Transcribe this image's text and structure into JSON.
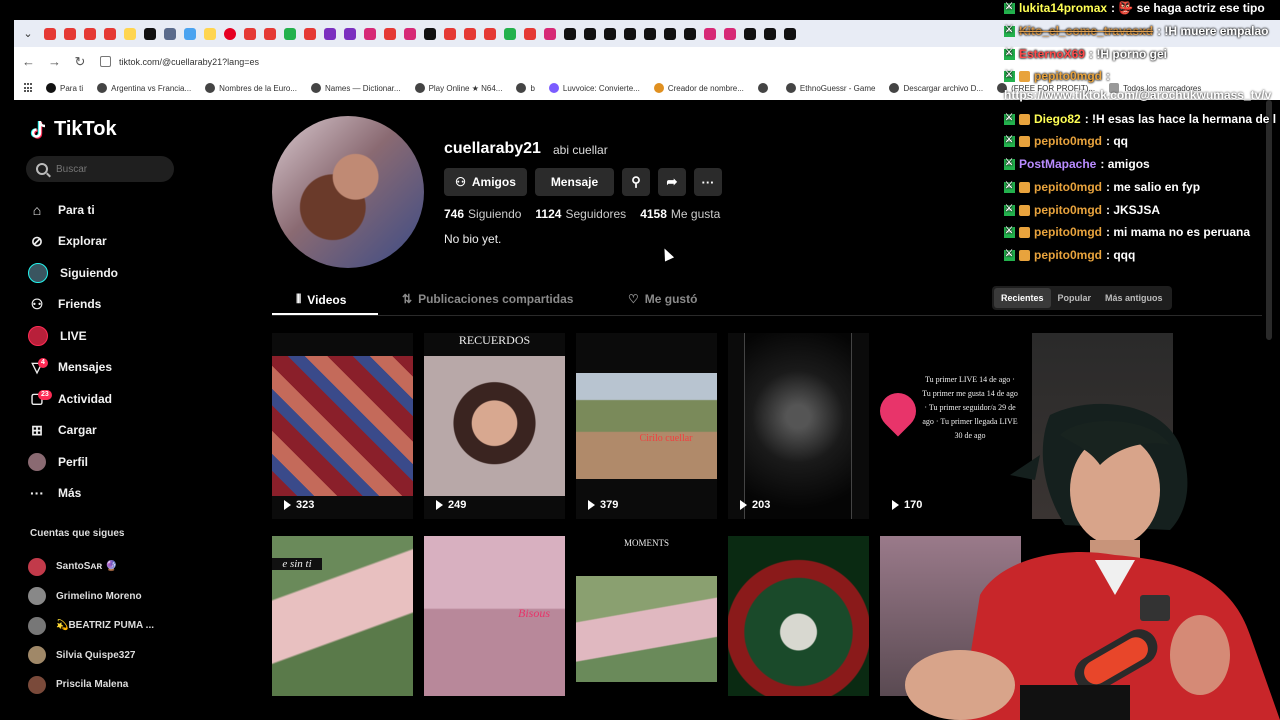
{
  "browser": {
    "url": "tiktok.com/@cuellaraby21?lang=es",
    "bookmarks": [
      "Para ti",
      "Argentina vs Francia...",
      "Nombres de la Euro...",
      "Names — Dictionar...",
      "Play Online ★ N64...",
      "b",
      "Luvvoice: Convierte...",
      "Creador de nombre...",
      "",
      "EthnoGuessr - Game",
      "Descargar archivo D...",
      "(FREE FOR PROFIT)..."
    ],
    "all_bookmarks": "Todos los marcadores"
  },
  "tiktok": {
    "logo": "TikTok",
    "search_placeholder": "Buscar",
    "nav": [
      {
        "label": "Para ti",
        "icon": "home-icon"
      },
      {
        "label": "Explorar",
        "icon": "compass-icon"
      },
      {
        "label": "Siguiendo",
        "icon": "following-avatar-icon"
      },
      {
        "label": "Friends",
        "icon": "friends-icon"
      },
      {
        "label": "LIVE",
        "icon": "live-icon"
      },
      {
        "label": "Mensajes",
        "icon": "messages-icon",
        "badge": "4"
      },
      {
        "label": "Actividad",
        "icon": "activity-icon",
        "badge": "23"
      },
      {
        "label": "Cargar",
        "icon": "upload-icon"
      },
      {
        "label": "Perfil",
        "icon": "profile-avatar-icon"
      },
      {
        "label": "Más",
        "icon": "more-icon"
      }
    ],
    "following_title": "Cuentas que sigues",
    "following": [
      {
        "name": "SantoSᴀʀ 🔮",
        "color": "#c23a4a"
      },
      {
        "name": "Grimelino Moreno",
        "color": "#888888"
      },
      {
        "name": "💫BEATRIZ PUMA ...",
        "color": "#777777"
      },
      {
        "name": "Silvia Quispe327",
        "color": "#a08868"
      },
      {
        "name": "Priscila Malena",
        "color": "#7a4a3a"
      }
    ]
  },
  "profile": {
    "username": "cuellaraby21",
    "nickname": "abi cuellar",
    "buttons": {
      "friends": "Amigos",
      "message": "Mensaje"
    },
    "stats": [
      {
        "value": "746",
        "label": "Siguiendo"
      },
      {
        "value": "1124",
        "label": "Seguidores"
      },
      {
        "value": "4158",
        "label": "Me gusta"
      }
    ],
    "bio": "No bio yet."
  },
  "tabs": {
    "videos": "Videos",
    "reposts": "Publicaciones compartidas",
    "liked": "Me gustó",
    "sort": [
      "Recientes",
      "Popular",
      "Más antiguos"
    ]
  },
  "videos": [
    {
      "views": "323"
    },
    {
      "views": "249",
      "caption": "RECUERDOS"
    },
    {
      "views": "379",
      "caption": "Cirilo cuellar"
    },
    {
      "views": "203"
    },
    {
      "views": "170",
      "caption": "Tu primer LIVE 14 de ago · Tu primer me gusta 14 de ago · Tu primer seguidor/a 29 de ago · Tu primer llegada LIVE 30 de ago"
    },
    {
      "views": ""
    },
    {
      "views": "",
      "caption": "e sin ti"
    },
    {
      "views": "",
      "caption": "Bisous"
    },
    {
      "views": "",
      "caption": "MOMENTS"
    },
    {
      "views": ""
    },
    {
      "views": ""
    }
  ],
  "chat": [
    {
      "user": "lukita14promax",
      "msg": ": 👺 se haga actriz ese tipo",
      "color": "#ffff55",
      "mod": true,
      "sub": false
    },
    {
      "user": "Kito_el_come_travasxd",
      "msg": ": !H muere empalao",
      "color": "#e0a050",
      "mod": true,
      "sub": false
    },
    {
      "user": "EsternoX69",
      "msg": ": !H porno gei",
      "color": "#ff4b4b",
      "mod": true,
      "sub": false
    },
    {
      "user": "pepito0mgd",
      "msg": ":",
      "color": "#e8a33d",
      "mod": true,
      "sub": true
    },
    {
      "user": "Diego82",
      "msg": ": !H esas las hace la hermana de l",
      "color": "#ffff55",
      "mod": true,
      "sub": false
    },
    {
      "user": "pepito0mgd",
      "msg": ": qq",
      "color": "#e8a33d",
      "mod": true,
      "sub": true
    },
    {
      "user": "PostMapache",
      "msg": ": amigos",
      "color": "#b98bff",
      "mod": true,
      "sub": false
    },
    {
      "user": "pepito0mgd",
      "msg": ": me salio en fyp",
      "color": "#e8a33d",
      "mod": true,
      "sub": true
    },
    {
      "user": "pepito0mgd",
      "msg": ": JKSJSA",
      "color": "#e8a33d",
      "mod": true,
      "sub": true
    },
    {
      "user": "pepito0mgd",
      "msg": ": mi mama no es peruana",
      "color": "#e8a33d",
      "mod": true,
      "sub": true
    },
    {
      "user": "pepito0mgd",
      "msg": ": qqq",
      "color": "#e8a33d",
      "mod": true,
      "sub": true
    }
  ],
  "chat_url": "https://www.tiktok.com/@arochukwumass_tv/v"
}
